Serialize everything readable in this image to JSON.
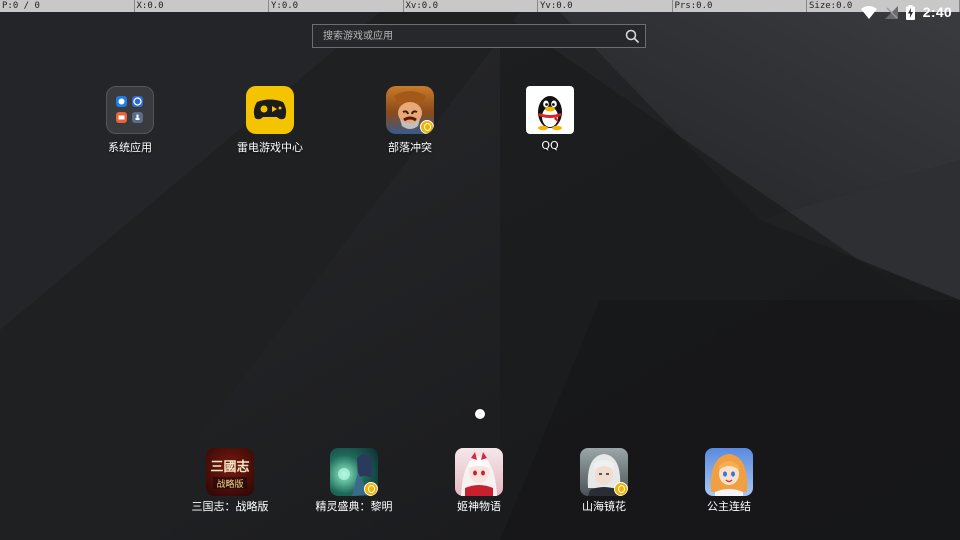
{
  "debug_bar": [
    {
      "text": "P:0 / 0"
    },
    {
      "text": "X:0.0"
    },
    {
      "text": "Y:0.0"
    },
    {
      "text": "Xv:0.0"
    },
    {
      "text": "Yv:0.0"
    },
    {
      "text": "Prs:0.0"
    },
    {
      "text": "Size:0.0"
    }
  ],
  "status_bar": {
    "time": "2:40"
  },
  "search": {
    "placeholder": "搜索游戏或应用"
  },
  "desktop": {
    "apps": [
      {
        "label": "系统应用",
        "icon": "system-apps-folder-icon"
      },
      {
        "label": "雷电游戏中心",
        "icon": "game-center-icon"
      },
      {
        "label": "部落冲突",
        "icon": "clash-of-clans-icon"
      },
      {
        "label": "QQ",
        "icon": "qq-penguin-icon"
      }
    ]
  },
  "pager": {
    "current_page": 1,
    "total_pages": 1
  },
  "dock": {
    "apps": [
      {
        "label": "三国志：战略版",
        "icon": "three-kingdoms-icon",
        "icon_text_top": "三國志",
        "icon_text_bottom": "战略版"
      },
      {
        "label": "精灵盛典：黎明",
        "icon": "elf-festival-icon"
      },
      {
        "label": "姬神物语",
        "icon": "goddess-story-icon"
      },
      {
        "label": "山海镜花",
        "icon": "mountain-sea-mirror-icon"
      },
      {
        "label": "公主连结",
        "icon": "princess-connect-icon"
      }
    ]
  },
  "colors": {
    "wallpaper": "#1d1e20",
    "game_center_bg": "#f5c400",
    "badge": "#f3b400"
  }
}
